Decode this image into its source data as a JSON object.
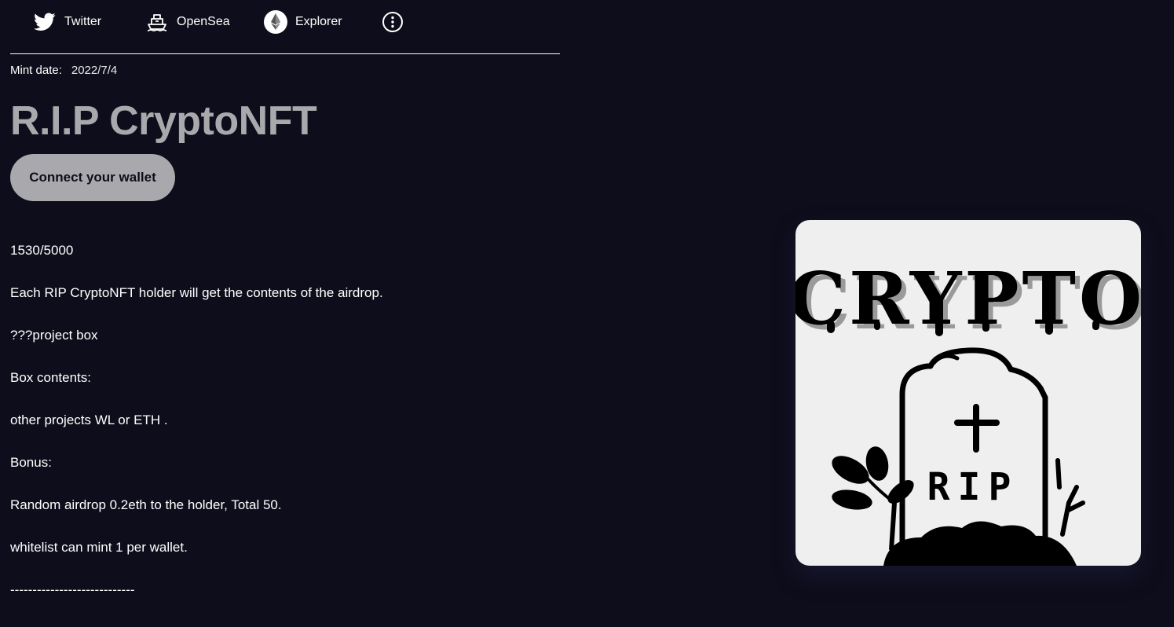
{
  "nav": {
    "twitter_label": "Twitter",
    "opensea_label": "OpenSea",
    "explorer_label": "Explorer"
  },
  "mint": {
    "label": "Mint date:",
    "value": "2022/7/4"
  },
  "title": "R.I.P CryptoNFT",
  "connect_button_label": "Connect your wallet",
  "info": {
    "supply": "1530/5000",
    "line1": "Each RIP CryptoNFT holder will get the contents of the airdrop.",
    "line2": "???project box",
    "line3": "Box contents:",
    "line4": "other projects WL or ETH .",
    "line5": "Bonus:",
    "line6": "Random airdrop 0.2eth to the holder, Total 50.",
    "line7": "whitelist can mint 1 per wallet.",
    "line8": "----------------------------"
  },
  "artwork": {
    "heading": "CRYPTO",
    "tombstone_text": "RIP"
  },
  "colors": {
    "background": "#0e0d1b",
    "title": "#a9a9ad",
    "button": "#a9a9ad",
    "card": "#efefef"
  }
}
